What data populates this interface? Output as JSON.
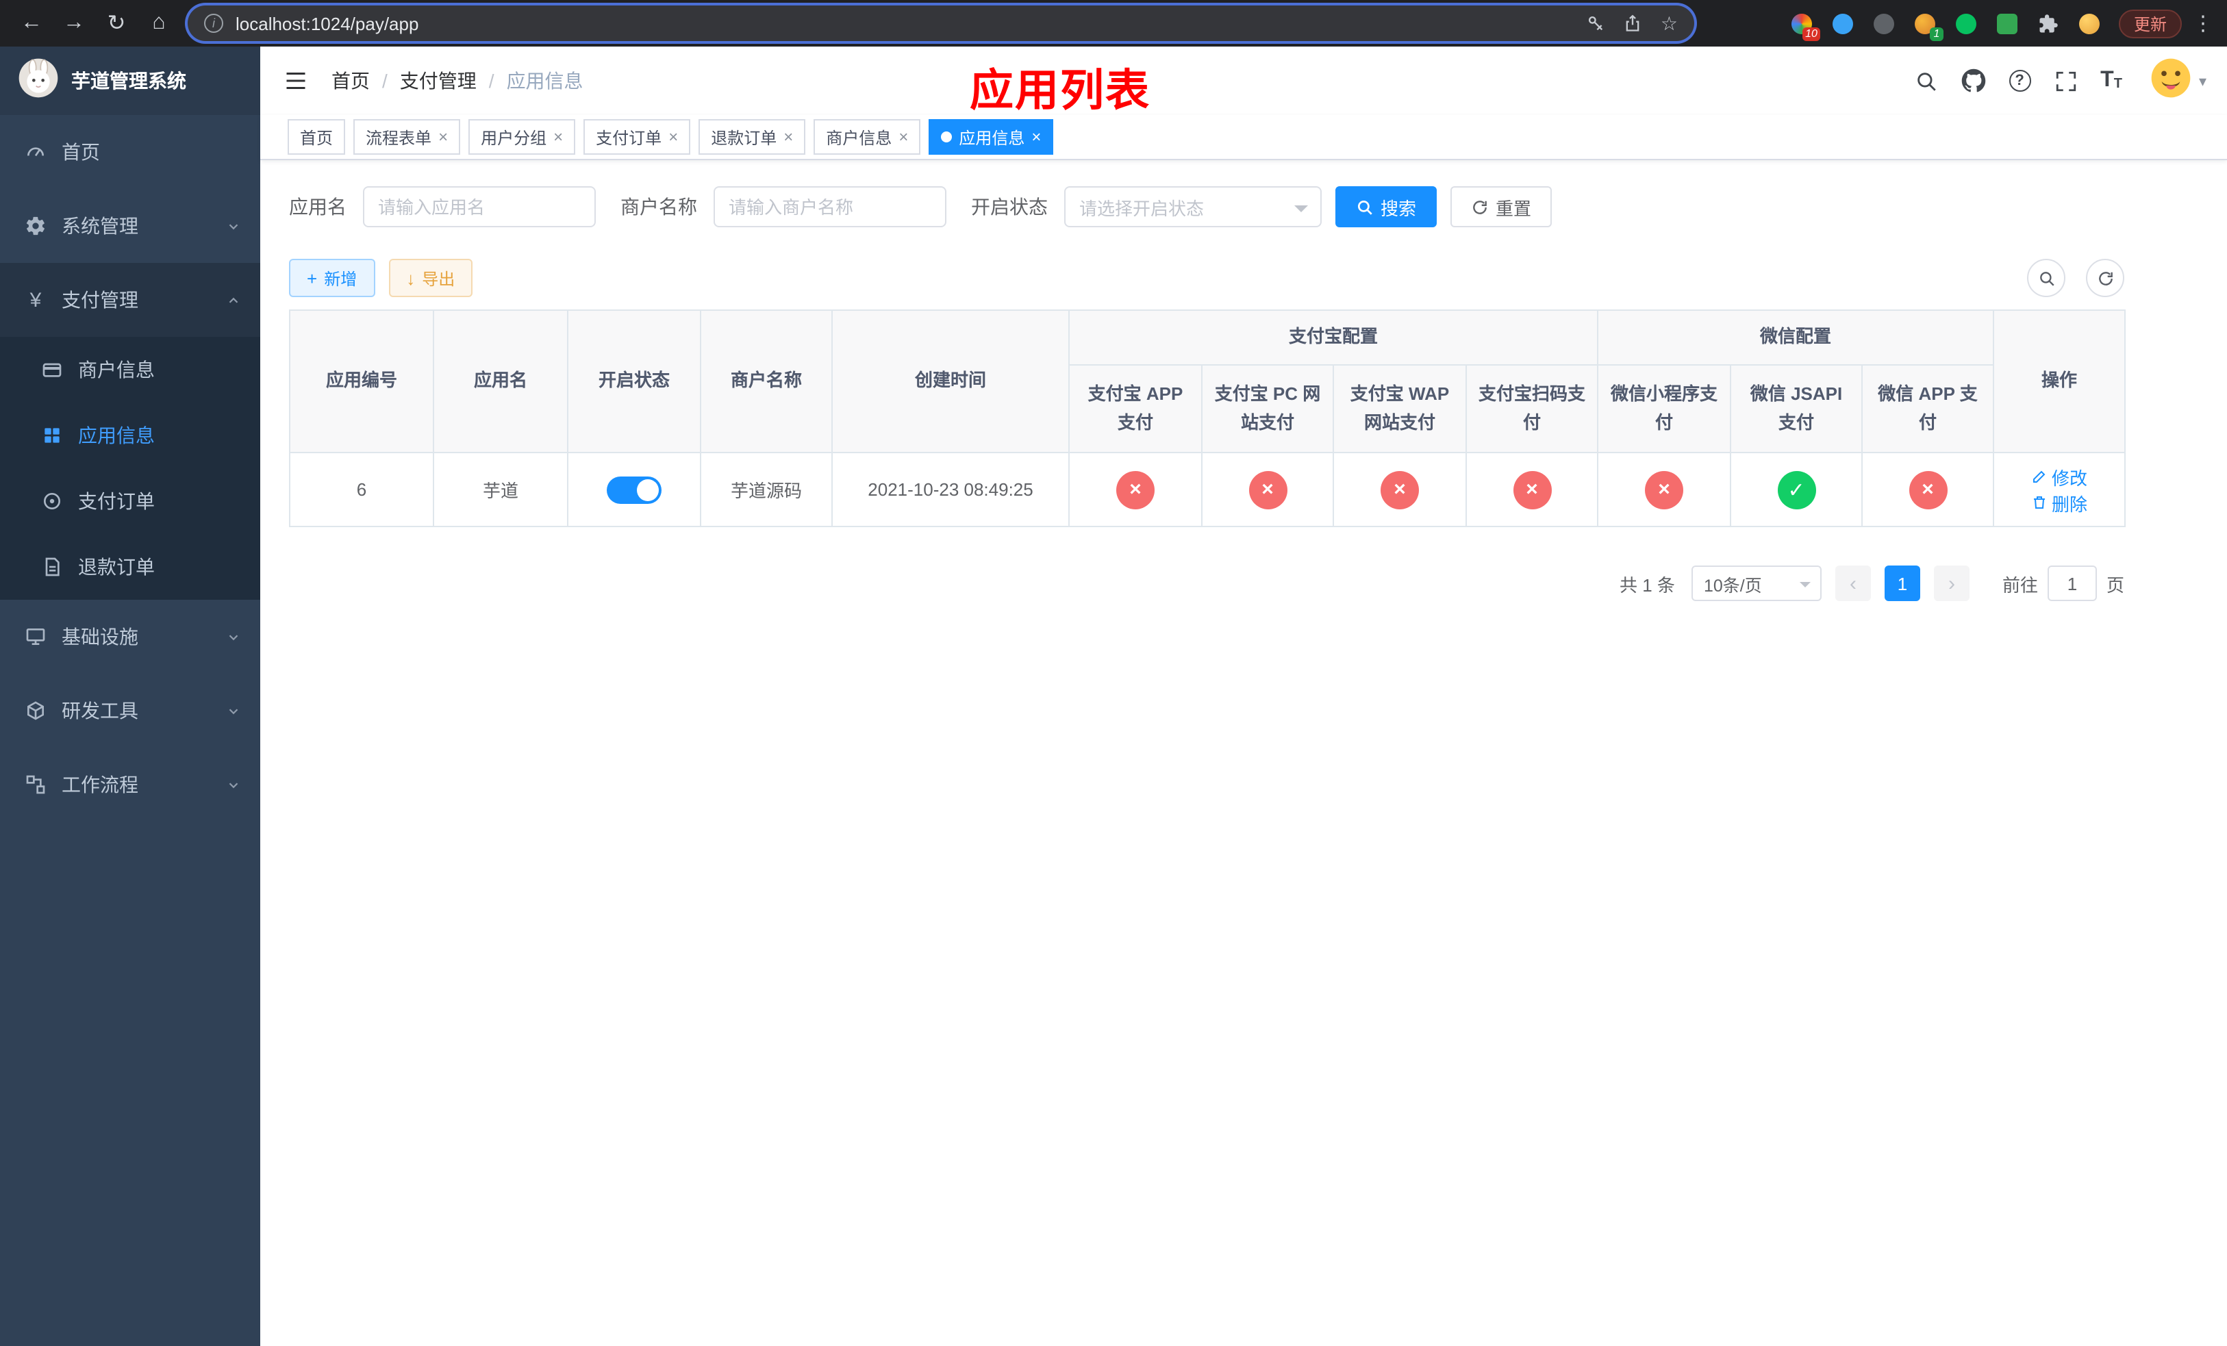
{
  "colors": {
    "accent": "#1890ff",
    "sidebar_active": "#409eff",
    "success": "#13ce66",
    "danger": "#f56c6c",
    "warning": "#e6a23c",
    "title_red": "#ff0000",
    "sidebar_bg": "#304156",
    "sidebar_submenu_bg": "#1f2d3d"
  },
  "icons": {
    "back": "←",
    "forward": "→",
    "reload": "↻",
    "home": "⌂",
    "info": "i",
    "star": "☆",
    "kebab": "⋮",
    "close": "×",
    "plus": "+",
    "download": "↓",
    "check": "✓",
    "cross": "×",
    "prev": "‹",
    "next": "›",
    "caret_down": "▾",
    "yen": "¥",
    "question": "?"
  },
  "browser": {
    "url": "localhost:1024/pay/app",
    "update_label": "更新",
    "extension_badge_1": "10",
    "extension_badge_2": "1"
  },
  "sidebar": {
    "title": "芋道管理系统",
    "home": "首页",
    "system": "系统管理",
    "payment": "支付管理",
    "merchant": "商户信息",
    "app": "应用信息",
    "pay_order": "支付订单",
    "refund_order": "退款订单",
    "infra": "基础设施",
    "devtool": "研发工具",
    "workflow": "工作流程"
  },
  "header": {
    "breadcrumb": [
      "首页",
      "支付管理",
      "应用信息"
    ],
    "separator": "/",
    "page_title": "应用列表"
  },
  "tabs": [
    {
      "label": "首页"
    },
    {
      "label": "流程表单"
    },
    {
      "label": "用户分组"
    },
    {
      "label": "支付订单"
    },
    {
      "label": "退款订单"
    },
    {
      "label": "商户信息"
    },
    {
      "label": "应用信息"
    }
  ],
  "filters": {
    "app_name_label": "应用名",
    "app_name_placeholder": "请输入应用名",
    "merchant_label": "商户名称",
    "merchant_placeholder": "请输入商户名称",
    "status_label": "开启状态",
    "status_placeholder": "请选择开启状态",
    "search": "搜索",
    "reset": "重置"
  },
  "toolbar": {
    "add": "新增",
    "export": "导出"
  },
  "table": {
    "headers": {
      "app_id": "应用编号",
      "app_name": "应用名",
      "status": "开启状态",
      "merchant": "商户名称",
      "created": "创建时间",
      "alipay_group": "支付宝配置",
      "wechat_group": "微信配置",
      "alipay_app": "支付宝 APP 支付",
      "alipay_pc": "支付宝 PC 网站支付",
      "alipay_wap": "支付宝 WAP 网站支付",
      "alipay_qr": "支付宝扫码支付",
      "wechat_lite": "微信小程序支付",
      "wechat_jsapi": "微信 JSAPI 支付",
      "wechat_app": "微信 APP 支付",
      "actions": "操作"
    },
    "rows": [
      {
        "id": "6",
        "name": "芋道",
        "enabled": true,
        "merchant": "芋道源码",
        "created": "2021-10-23 08:49:25",
        "configs": [
          false,
          false,
          false,
          false,
          false,
          true,
          false
        ],
        "edit": "修改",
        "delete": "删除"
      }
    ]
  },
  "pagination": {
    "total": "共 1 条",
    "page_size": "10条/页",
    "page": "1",
    "goto_label": "前往",
    "goto_value": "1",
    "page_unit": "页"
  }
}
